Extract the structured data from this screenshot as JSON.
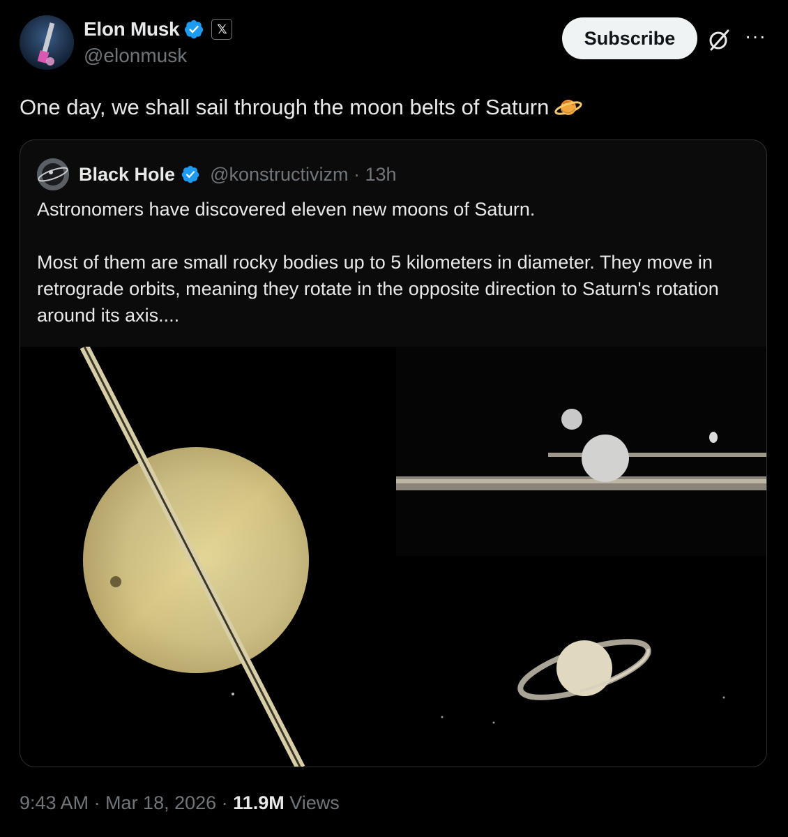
{
  "author": {
    "name": "Elon Musk",
    "handle": "@elonmusk",
    "verified_icon": "verified-badge-icon",
    "affiliate_icon": "x-logo-icon"
  },
  "actions": {
    "subscribe_label": "Subscribe",
    "grok_icon": "grok-icon",
    "more_icon": "more-icon"
  },
  "tweet": {
    "text": "One day, we shall sail through the moon belts of Saturn",
    "emoji_icon": "ringed-planet-emoji"
  },
  "quote": {
    "name": "Black Hole",
    "handle": "@konstructivizm · 13h",
    "paragraph1": "Astronomers have discovered eleven new moons of Saturn.",
    "paragraph2": "Most of them are small rocky bodies up to 5 kilometers in diameter. They move in retrograde orbits, meaning they rotate in the opposite direction to Saturn's rotation around its axis....",
    "media": [
      "saturn-closeup-image",
      "saturn-moons-rings-image",
      "saturn-distant-image"
    ]
  },
  "footer": {
    "timestamp": "9:43 AM · Mar 18, 2026 · ",
    "views_count": "11.9M",
    "views_label": " Views"
  },
  "colors": {
    "background": "#000000",
    "text": "#e7e9ea",
    "secondary": "#71767b",
    "verified": "#1d9bf0",
    "border": "#2f3336"
  }
}
